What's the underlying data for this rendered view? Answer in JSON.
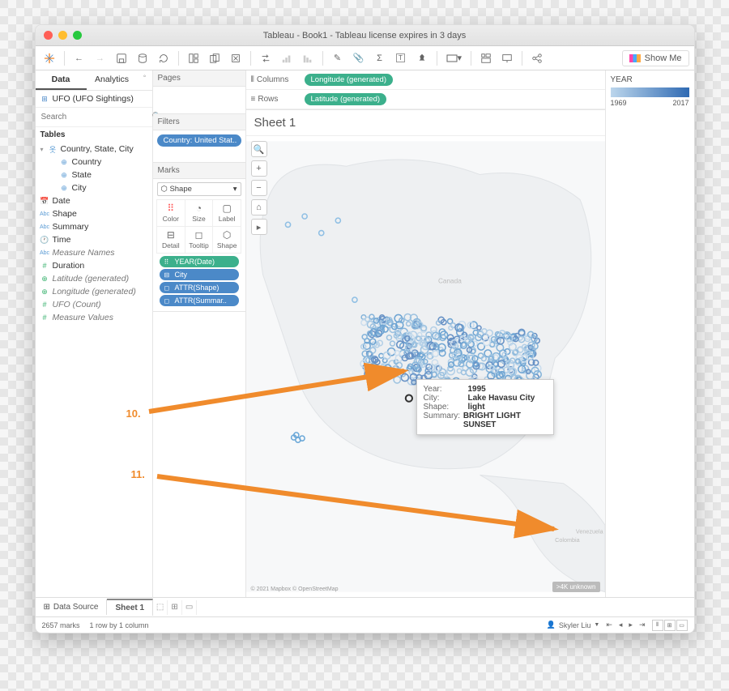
{
  "window": {
    "title": "Tableau - Book1 - Tableau license expires in 3 days"
  },
  "toolbar": {
    "showme": "Show Me"
  },
  "datapane": {
    "tabs": {
      "data": "Data",
      "analytics": "Analytics"
    },
    "datasource": "UFO (UFO Sightings)",
    "search_placeholder": "Search",
    "tables_header": "Tables",
    "hierarchy": "Country, State, City",
    "hier": {
      "country": "Country",
      "state": "State",
      "city": "City"
    },
    "dims": {
      "date": "Date",
      "shape": "Shape",
      "summary": "Summary",
      "time": "Time",
      "measure_names": "Measure Names"
    },
    "meas": {
      "duration": "Duration",
      "lat": "Latitude (generated)",
      "lon": "Longitude (generated)",
      "ufo_count": "UFO (Count)",
      "measure_values": "Measure Values"
    }
  },
  "side": {
    "pages": "Pages",
    "filters": "Filters",
    "filter_pill": "Country: United Stat..",
    "marks": "Marks",
    "mark_type": "Shape",
    "cells": {
      "color": "Color",
      "size": "Size",
      "label": "Label",
      "detail": "Detail",
      "tooltip": "Tooltip",
      "shape": "Shape"
    },
    "pills": {
      "year": "YEAR(Date)",
      "city": "City",
      "attr_shape": "ATTR(Shape)",
      "attr_summary": "ATTR(Summar.."
    }
  },
  "shelves": {
    "columns_label": "Columns",
    "columns_pill": "Longitude (generated)",
    "rows_label": "Rows",
    "rows_pill": "Latitude (generated)"
  },
  "sheet": {
    "title": "Sheet 1"
  },
  "tooltip": {
    "year_k": "Year:",
    "year_v": "1995",
    "city_k": "City:",
    "city_v": "Lake Havasu City",
    "shape_k": "Shape:",
    "shape_v": "light",
    "summary_k": "Summary:",
    "summary_v": "BRIGHT LIGHT SUNSET"
  },
  "map": {
    "credit": "© 2021 Mapbox © OpenStreetMap",
    "unknown": ">4K unknown",
    "canada": "Canada",
    "colombia": "Colombia",
    "venezuela": "Venezuela"
  },
  "legend": {
    "title": "YEAR",
    "min": "1969",
    "max": "2017"
  },
  "annotations": {
    "a10": "10.",
    "a11": "11."
  },
  "tabs": {
    "datasource": "Data Source",
    "sheet": "Sheet 1"
  },
  "status": {
    "marks": "2657 marks",
    "rows": "1 row by 1 column",
    "user": "Skyler Liu"
  }
}
